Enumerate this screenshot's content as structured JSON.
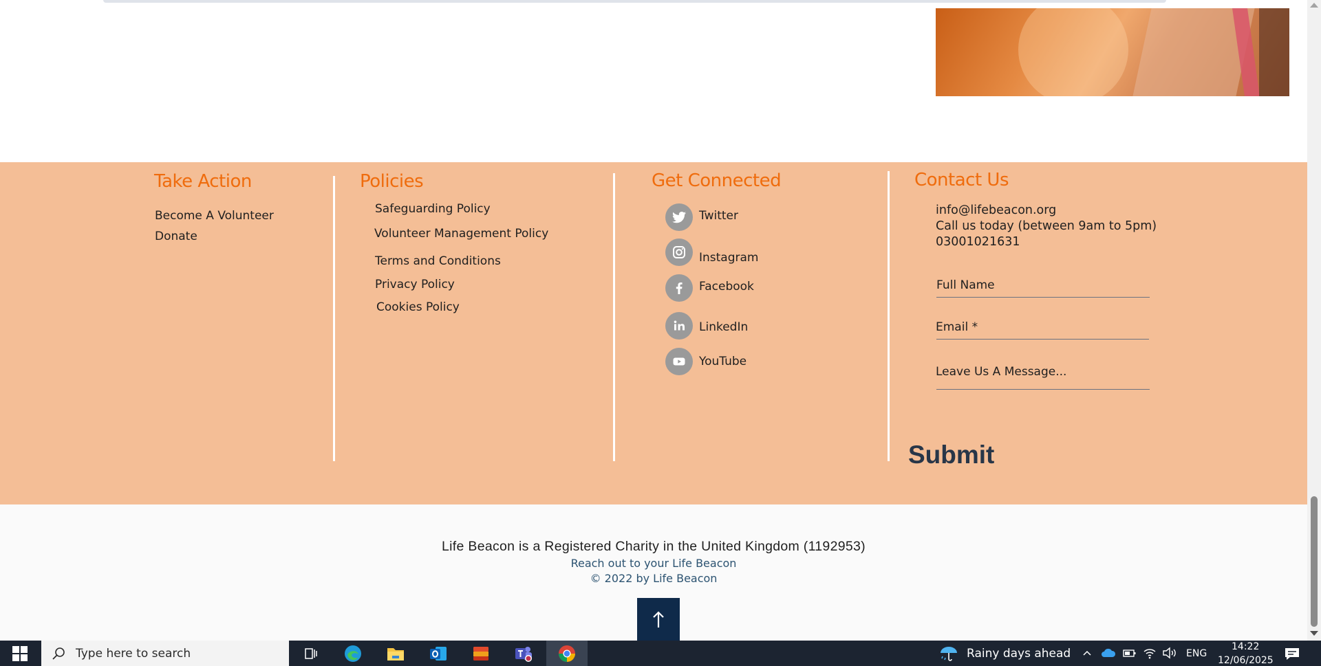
{
  "footer": {
    "take_action": {
      "title": "Take Action",
      "links": [
        "Become A Volunteer",
        "Donate"
      ]
    },
    "policies": {
      "title": "Policies",
      "links": [
        "Safeguarding Policy",
        "Volunteer Management Policy",
        "Terms and Conditions",
        "Privacy Policy",
        "Cookies Policy"
      ]
    },
    "get_connected": {
      "title": "Get Connected",
      "links": [
        {
          "label": "Twitter",
          "icon": "twitter-icon"
        },
        {
          "label": "Instagram",
          "icon": "instagram-icon"
        },
        {
          "label": "Facebook",
          "icon": "facebook-icon"
        },
        {
          "label": "LinkedIn",
          "icon": "linkedin-icon"
        },
        {
          "label": "YouTube",
          "icon": "youtube-icon"
        }
      ]
    },
    "contact": {
      "title": "Contact Us",
      "email": "info@lifebeacon.org",
      "call_text": "Call us today (between 9am to 5pm)",
      "phone": "03001021631",
      "form": {
        "full_name_label": "Full Name",
        "email_label": "Email *",
        "message_label": "Leave Us A Message...",
        "submit_label": "Submit"
      }
    }
  },
  "bottom": {
    "charity_text": "Life Beacon is a Registered Charity in the United Kingdom (1192953)",
    "reach_text": "Reach out to your Life Beacon",
    "copyright": "© 2022 by Life Beacon"
  },
  "taskbar": {
    "search_placeholder": "Type here to search",
    "weather": "Rainy days ahead",
    "language": "ENG",
    "time": "14:22",
    "date": "12/06/2025",
    "apps": [
      "task-view-icon",
      "edge-icon",
      "file-explorer-icon",
      "outlook-icon",
      "files-app-icon",
      "teams-icon",
      "chrome-icon"
    ]
  },
  "colors": {
    "footer_bg": "#f4be96",
    "title_orange": "#ef6c0d",
    "submit_text": "#283648",
    "back_to_top_bg": "#0f2a4a",
    "taskbar_bg": "#1c2431",
    "link_blue": "#2c5371"
  }
}
